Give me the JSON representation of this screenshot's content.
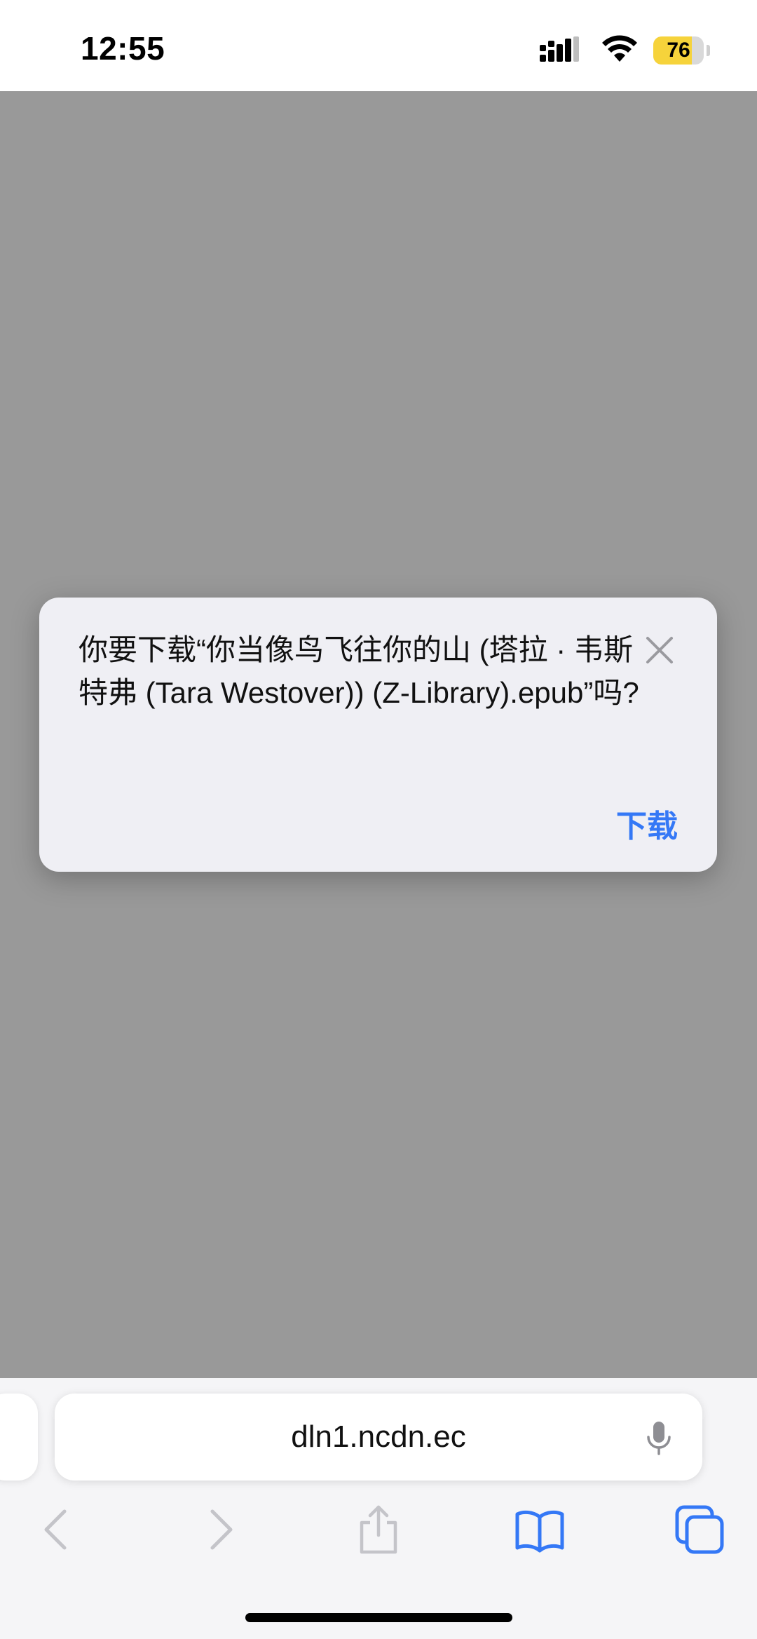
{
  "status_bar": {
    "time": "12:55",
    "battery_level": "76",
    "battery_percent": 76,
    "icons": [
      "cellular-signal-icon",
      "wifi-icon",
      "battery-icon"
    ]
  },
  "dialog": {
    "message": "你要下载“你当像鸟飞往你的山 (塔拉 · 韦斯特弗 (Tara Westover)) (Z-Library).epub”吗?",
    "download_label": "下载",
    "close_icon": "close-icon"
  },
  "address_bar": {
    "url": "dln1.ncdn.ec",
    "mic_icon": "microphone-icon"
  },
  "toolbar": {
    "icons": [
      "back-icon",
      "forward-icon",
      "share-icon",
      "bookmarks-icon",
      "tabs-icon"
    ]
  },
  "colors": {
    "accent": "#3478f6",
    "dim_overlay": "#999999",
    "battery_fill": "#f6d33b",
    "dialog_bg": "#efeff4"
  }
}
